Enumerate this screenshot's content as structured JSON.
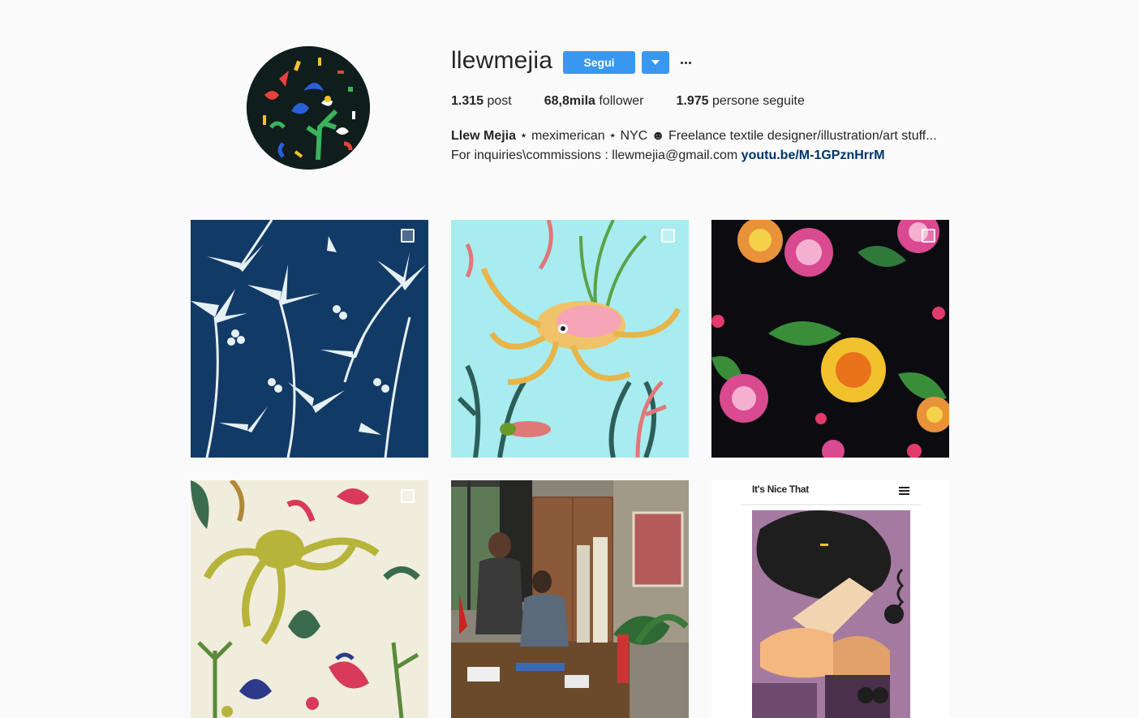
{
  "profile": {
    "username": "llewmejia",
    "follow_label": "Segui",
    "stats": {
      "posts_count": "1.315",
      "posts_label": "post",
      "followers_count": "68,8mila",
      "followers_label": "follower",
      "following_count": "1.975",
      "following_label": "persone seguite"
    },
    "bio": {
      "name": "Llew Mejia",
      "text": " ⋆ meximerican ⋆ NYC ☻ Freelance textile designer/illustration/art stuff... For inquiries\\commissions : llewmejia@gmail.com ",
      "link": "youtu.be/M-1GPznHrrM"
    }
  },
  "posts": [
    {
      "id": "palms-navy",
      "multiple": true
    },
    {
      "id": "octopus-seaweed",
      "multiple": true
    },
    {
      "id": "flowers-black",
      "multiple": true
    },
    {
      "id": "octopus-cream",
      "multiple": true
    },
    {
      "id": "studio-photo",
      "multiple": false
    },
    {
      "id": "its-nice-that",
      "multiple": false,
      "header_text": "It's Nice That"
    }
  ],
  "colors": {
    "accent": "#3897f0",
    "link": "#003569",
    "background": "#fafafa"
  },
  "icons": {
    "dropdown": "chevron-down-icon",
    "more": "more-options-icon",
    "multi": "multiple-posts-icon"
  }
}
